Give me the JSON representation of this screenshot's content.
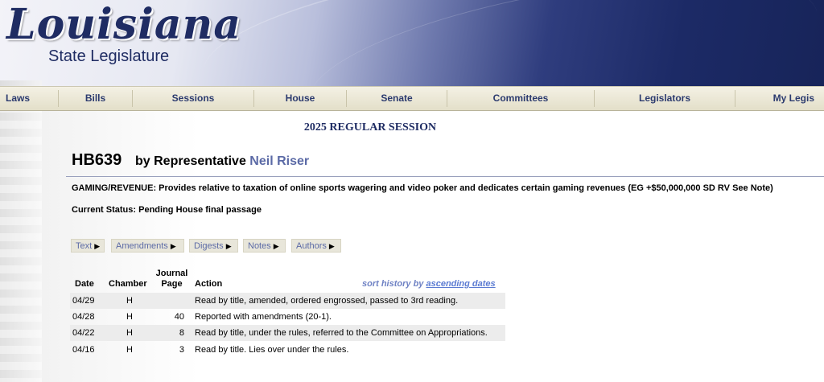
{
  "header": {
    "logo_main": "Louisiana",
    "logo_sub": "State Legislature"
  },
  "nav": {
    "items": [
      "Laws",
      "Bills",
      "Sessions",
      "House",
      "Senate",
      "Committees",
      "Legislators",
      "My Legis"
    ]
  },
  "session": "2025 REGULAR SESSION",
  "bill": {
    "number": "HB639",
    "by_prefix": "by Representative",
    "representative": "Neil Riser",
    "description": "GAMING/REVENUE:  Provides relative to taxation of online sports wagering and video poker and dedicates certain gaming revenues (EG +$50,000,000 SD RV See Note)",
    "status_label": "Current Status:",
    "status_value": "Pending House final passage"
  },
  "doc_tabs": [
    "Text",
    "Amendments",
    "Digests",
    "Notes",
    "Authors"
  ],
  "history": {
    "headers": {
      "date": "Date",
      "chamber": "Chamber",
      "journal_line1": "Journal",
      "journal_line2": "Page",
      "action": "Action"
    },
    "sort_prefix": "sort history by",
    "sort_link": "ascending dates",
    "rows": [
      {
        "date": "04/29",
        "chamber": "H",
        "page": "",
        "action": "Read by title, amended, ordered engrossed, passed to 3rd reading."
      },
      {
        "date": "04/28",
        "chamber": "H",
        "page": "40",
        "action": "Reported with amendments (20-1)."
      },
      {
        "date": "04/22",
        "chamber": "H",
        "page": "8",
        "action": "Read by title, under the rules, referred to the Committee on Appropriations."
      },
      {
        "date": "04/16",
        "chamber": "H",
        "page": "3",
        "action": "Read by title. Lies over under the rules."
      }
    ]
  }
}
